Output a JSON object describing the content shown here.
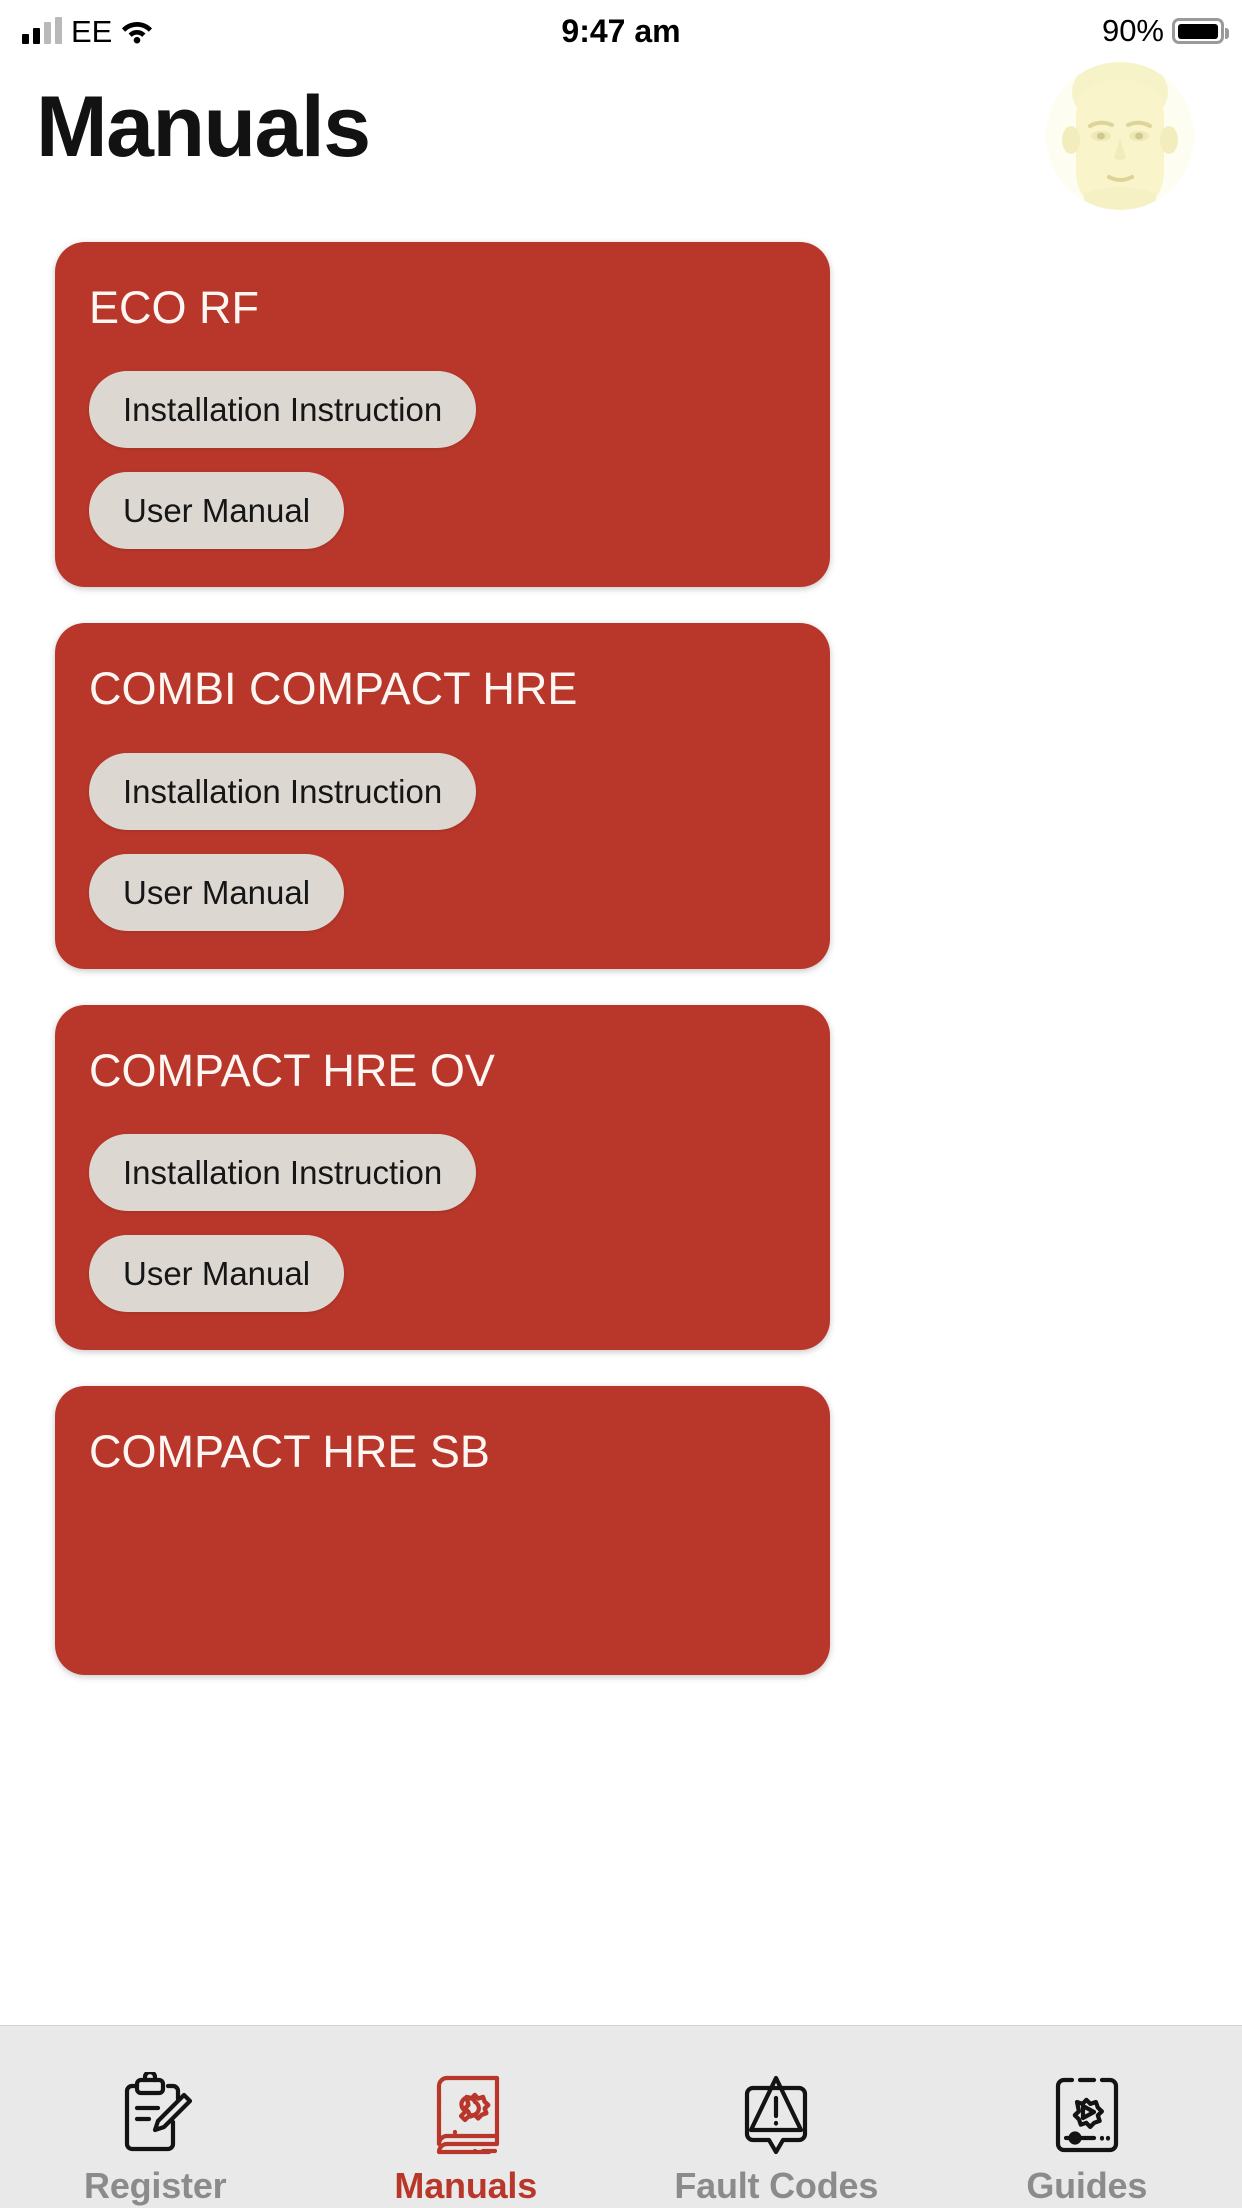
{
  "status_bar": {
    "carrier": "EE",
    "signal_icon": "signal-bars-icon",
    "wifi_icon": "wifi-icon",
    "time": "9:47 am",
    "battery_percent": "90%",
    "battery_icon": "battery-icon"
  },
  "header": {
    "title": "Manuals",
    "avatar_name": "user-avatar"
  },
  "theme": {
    "card_red": "#B8372A",
    "pill_grey": "#DCD7D1",
    "tabbar_grey": "#E9E9E9",
    "active_tab_color": "#B8372A",
    "inactive_tab_color": "#8B8B8B"
  },
  "manuals": [
    {
      "title": "ECO RF",
      "buttons": [
        {
          "label": "Installation Instruction"
        },
        {
          "label": "User Manual"
        }
      ]
    },
    {
      "title": "COMBI COMPACT HRE",
      "buttons": [
        {
          "label": "Installation Instruction"
        },
        {
          "label": "User Manual"
        }
      ]
    },
    {
      "title": "COMPACT HRE OV",
      "buttons": [
        {
          "label": "Installation Instruction"
        },
        {
          "label": "User Manual"
        }
      ]
    },
    {
      "title": "COMPACT HRE SB",
      "buttons": []
    }
  ],
  "tabbar": {
    "items": [
      {
        "label": "Register",
        "icon": "clipboard-pencil-icon",
        "active": false
      },
      {
        "label": "Manuals",
        "icon": "book-gear-icon",
        "active": true
      },
      {
        "label": "Fault Codes",
        "icon": "warning-triangle-icon",
        "active": false
      },
      {
        "label": "Guides",
        "icon": "phone-gear-play-icon",
        "active": false
      }
    ]
  }
}
